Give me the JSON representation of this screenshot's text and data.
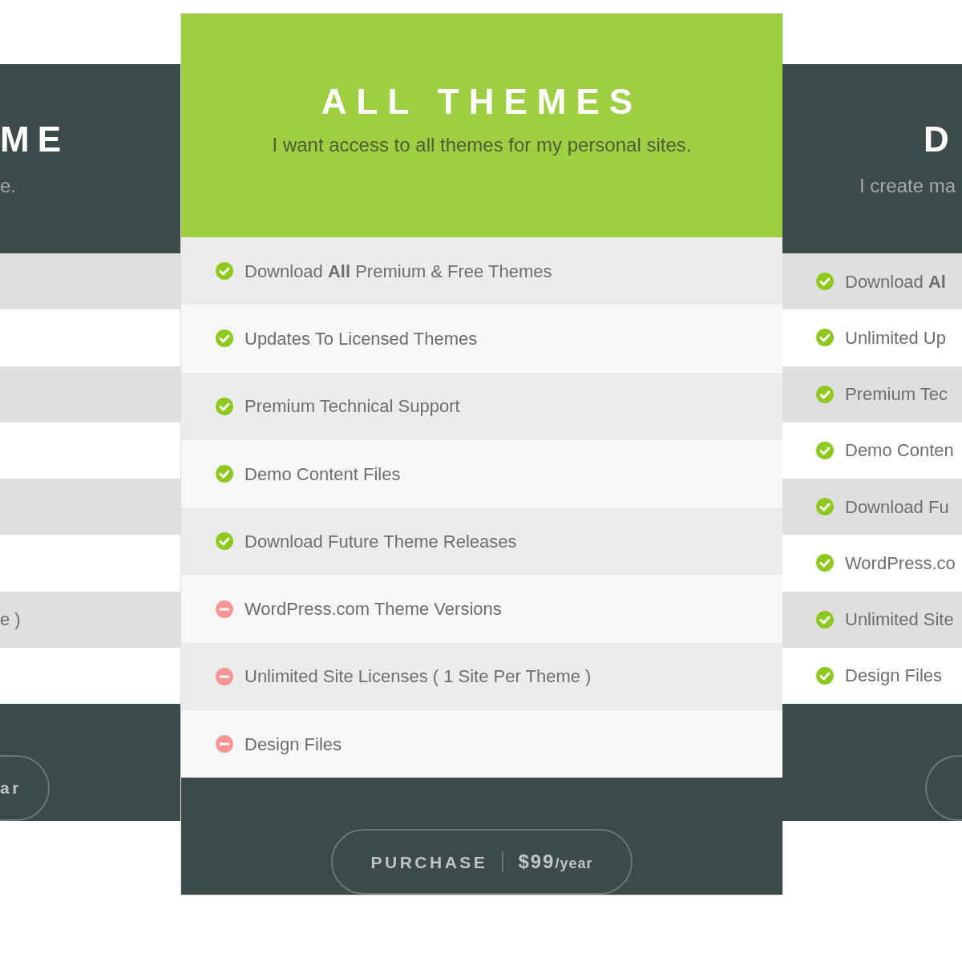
{
  "cards": [
    {
      "kind": "left",
      "title": "ME",
      "subtitle": "e.",
      "features": [
        {
          "shaded": true
        },
        {
          "shaded": false
        },
        {
          "shaded": true
        },
        {
          "shaded": false
        },
        {
          "shaded": true
        },
        {
          "shaded": false
        },
        {
          "shaded": true,
          "text": "e )"
        },
        {
          "shaded": false
        }
      ],
      "button": {
        "label": "ar"
      }
    },
    {
      "kind": "featured",
      "title": "ALL THEMES",
      "subtitle": "I want access to all themes for my personal sites.",
      "features": [
        {
          "text": "Download **All** Premium & Free Themes",
          "included": true
        },
        {
          "text": "Updates To Licensed Themes",
          "included": true
        },
        {
          "text": "Premium Technical Support",
          "included": true
        },
        {
          "text": "Demo Content Files",
          "included": true
        },
        {
          "text": "Download Future Theme Releases",
          "included": true
        },
        {
          "text": "WordPress.com Theme Versions",
          "included": false
        },
        {
          "text": "Unlimited Site Licenses ( 1 Site Per Theme )",
          "included": false
        },
        {
          "text": "Design Files",
          "included": false
        }
      ],
      "button": {
        "label": "PURCHASE",
        "price": "$99",
        "period": "/year"
      }
    },
    {
      "kind": "right",
      "title": "D",
      "subtitle": "I create ma",
      "features": [
        {
          "text": "Download **Al**",
          "included": true
        },
        {
          "text": "Unlimited Up",
          "included": true
        },
        {
          "text": "Premium Tec",
          "included": true
        },
        {
          "text": "Demo Conten",
          "included": true
        },
        {
          "text": "Download Fu",
          "included": true
        },
        {
          "text": "WordPress.co",
          "included": true
        },
        {
          "text": "Unlimited Site",
          "included": true
        },
        {
          "text": "Design Files",
          "included": true
        }
      ]
    }
  ]
}
